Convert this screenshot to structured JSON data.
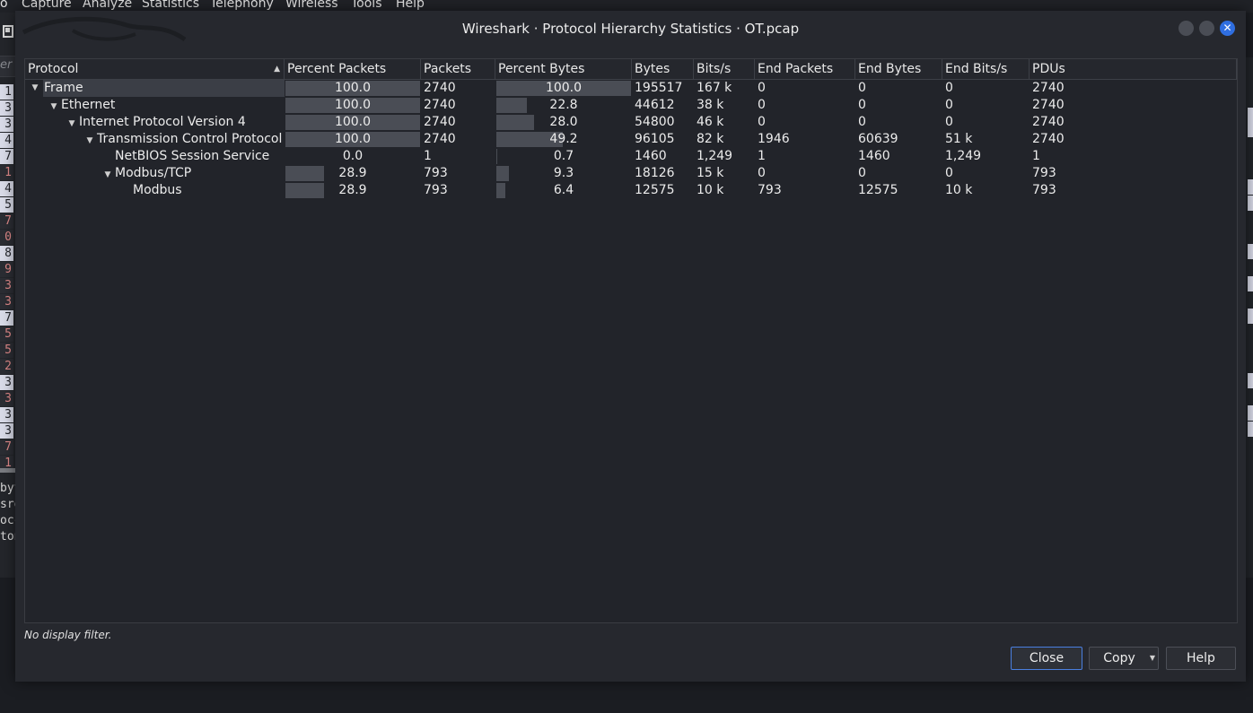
{
  "menu": [
    "o",
    "Capture",
    "Analyze",
    "Statistics",
    "Telephony",
    "Wireless",
    "Tools",
    "Help"
  ],
  "background": {
    "filter_text": "er",
    "row_numbers": [
      "1",
      "3",
      "3",
      "4",
      "7",
      "1",
      "4",
      "5",
      "7",
      "0",
      "8",
      "9",
      "3",
      "3",
      "7",
      "5",
      "5",
      "2",
      "3",
      "3",
      "3",
      "3",
      "7",
      "1"
    ],
    "bytes_lines": [
      "byt",
      "sro",
      "occ",
      "ton"
    ]
  },
  "dialog": {
    "title": "Wireshark · Protocol Hierarchy Statistics · OT.pcap",
    "window_buttons": [
      "minimize-icon",
      "maximize-icon",
      "close-icon"
    ],
    "columns": [
      "Protocol",
      "Percent Packets",
      "Packets",
      "Percent Bytes",
      "Bytes",
      "Bits/s",
      "End Packets",
      "End Bytes",
      "End Bits/s",
      "PDUs"
    ],
    "sort_column": "Protocol",
    "rows": [
      {
        "protocol": "Frame",
        "depth": 0,
        "expanded": true,
        "selected": true,
        "percent_packets": "100.0",
        "packets": "2740",
        "percent_bytes": "100.0",
        "bytes": "195517",
        "bits_s": "167 k",
        "end_packets": "0",
        "end_bytes": "0",
        "end_bits_s": "0",
        "pdus": "2740"
      },
      {
        "protocol": "Ethernet",
        "depth": 1,
        "expanded": true,
        "selected": false,
        "percent_packets": "100.0",
        "packets": "2740",
        "percent_bytes": "22.8",
        "bytes": "44612",
        "bits_s": "38 k",
        "end_packets": "0",
        "end_bytes": "0",
        "end_bits_s": "0",
        "pdus": "2740"
      },
      {
        "protocol": "Internet Protocol Version 4",
        "depth": 2,
        "expanded": true,
        "selected": false,
        "percent_packets": "100.0",
        "packets": "2740",
        "percent_bytes": "28.0",
        "bytes": "54800",
        "bits_s": "46 k",
        "end_packets": "0",
        "end_bytes": "0",
        "end_bits_s": "0",
        "pdus": "2740"
      },
      {
        "protocol": "Transmission Control Protocol",
        "depth": 3,
        "expanded": true,
        "selected": false,
        "percent_packets": "100.0",
        "packets": "2740",
        "percent_bytes": "49.2",
        "bytes": "96105",
        "bits_s": "82 k",
        "end_packets": "1946",
        "end_bytes": "60639",
        "end_bits_s": "51 k",
        "pdus": "2740"
      },
      {
        "protocol": "NetBIOS Session Service",
        "depth": 4,
        "expanded": null,
        "selected": false,
        "percent_packets": "0.0",
        "packets": "1",
        "percent_bytes": "0.7",
        "bytes": "1460",
        "bits_s": "1,249",
        "end_packets": "1",
        "end_bytes": "1460",
        "end_bits_s": "1,249",
        "pdus": "1"
      },
      {
        "protocol": "Modbus/TCP",
        "depth": 4,
        "expanded": true,
        "selected": false,
        "percent_packets": "28.9",
        "packets": "793",
        "percent_bytes": "9.3",
        "bytes": "18126",
        "bits_s": "15 k",
        "end_packets": "0",
        "end_bytes": "0",
        "end_bits_s": "0",
        "pdus": "793"
      },
      {
        "protocol": "Modbus",
        "depth": 5,
        "expanded": null,
        "selected": false,
        "percent_packets": "28.9",
        "packets": "793",
        "percent_bytes": "6.4",
        "bytes": "12575",
        "bits_s": "10 k",
        "end_packets": "793",
        "end_bytes": "12575",
        "end_bits_s": "10 k",
        "pdus": "793"
      }
    ],
    "status": "No display filter.",
    "buttons": {
      "close": "Close",
      "copy": "Copy",
      "help": "Help"
    }
  },
  "colors": {
    "accent": "#2f6ee0",
    "bar": "#4a4d55",
    "dialog_bg": "#26282e"
  }
}
